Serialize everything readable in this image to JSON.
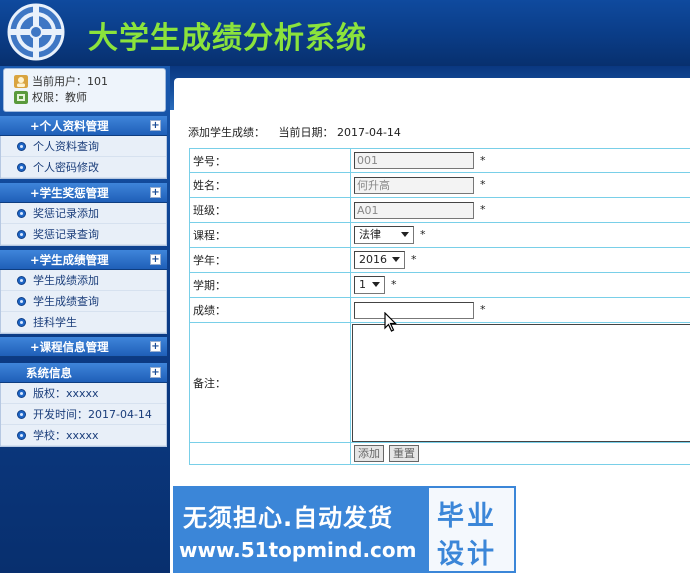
{
  "app": {
    "title": "大学生成绩分析系统"
  },
  "user": {
    "current_user": "当前用户：101",
    "role": "权限：教师"
  },
  "menu": [
    {
      "title": "+个人资料管理",
      "items": [
        "个人资料查询",
        "个人密码修改"
      ]
    },
    {
      "title": "+学生奖惩管理",
      "items": [
        "奖惩记录添加",
        "奖惩记录查询"
      ]
    },
    {
      "title": "+学生成绩管理",
      "items": [
        "学生成绩添加",
        "学生成绩查询",
        "挂科学生"
      ]
    },
    {
      "title": "+课程信息管理",
      "items": []
    },
    {
      "title": "系统信息",
      "items": [
        "版权：xxxxx",
        "开发时间：2017-04-14",
        "学校：xxxxx"
      ]
    }
  ],
  "menu_expand_glyph": "+",
  "page": {
    "heading": "添加学生成绩：",
    "date": "当前日期：  2017-04-14"
  },
  "form": {
    "student_no": {
      "label": "学号：",
      "value": "001"
    },
    "name": {
      "label": "姓名：",
      "value": "何升高"
    },
    "class": {
      "label": "班级：",
      "value": "A01"
    },
    "course": {
      "label": "课程：",
      "value": "法律"
    },
    "year": {
      "label": "学年：",
      "value": "2016"
    },
    "term": {
      "label": "学期：",
      "value": "1"
    },
    "score": {
      "label": "成绩：",
      "value": ""
    },
    "remark": {
      "label": "备注："
    },
    "required_mark": "*",
    "buttons": {
      "add": "添加",
      "reset": "重置"
    }
  },
  "watermark": {
    "line1": "无须担心.自动发货",
    "line2": "www.51topmind.com",
    "right1": "毕业",
    "right2": "设计"
  },
  "colors": {
    "header_bg": "#0a3c86",
    "title_green": "#8be33c",
    "table_border": "#79cfe8",
    "menu_head": "#2f72c8",
    "watermark_blue": "#3b86d8"
  },
  "icons": [
    "logo-emblem-icon",
    "user-icon",
    "permission-icon",
    "expand-plus-icon",
    "menu-bullet-icon",
    "dropdown-arrow-icon",
    "mouse-cursor-icon"
  ]
}
